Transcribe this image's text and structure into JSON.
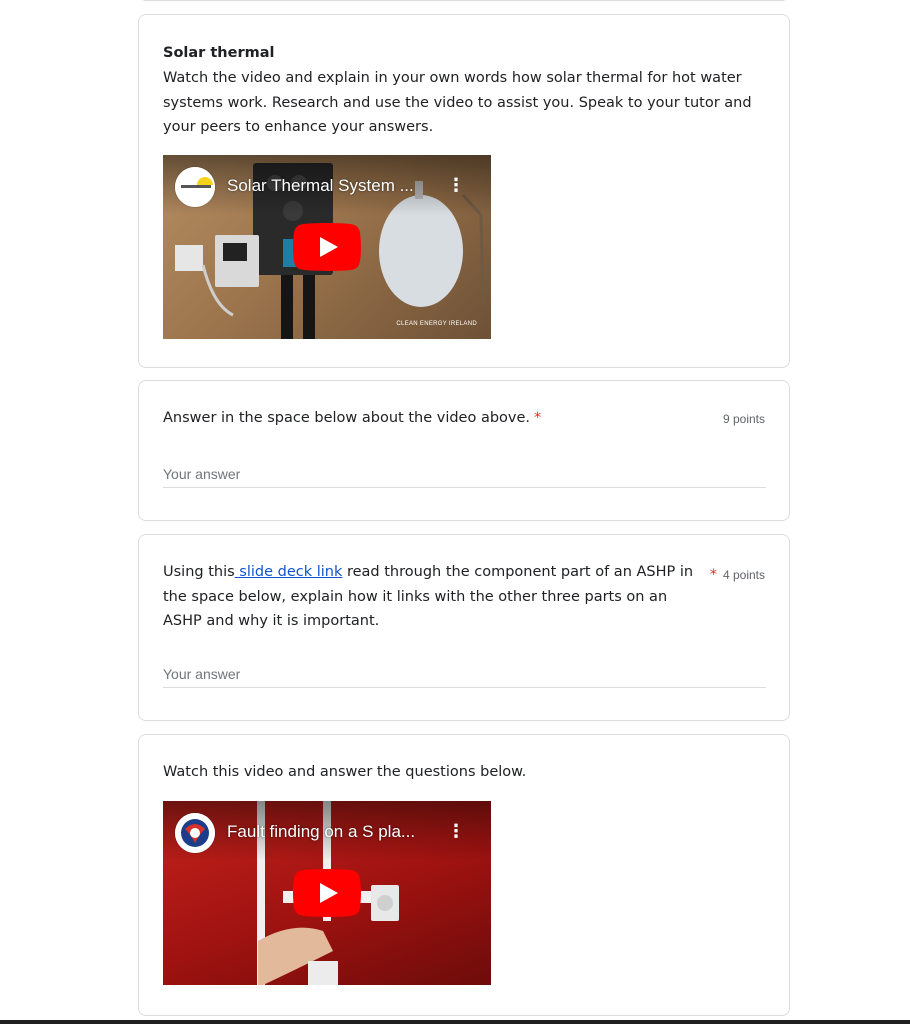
{
  "section": {
    "title": "Solar thermal",
    "description": "Watch the video and explain in your own words how solar thermal for hot water systems work. Research and use the video to assist you. Speak to your tutor and your peers to enhance your answers.",
    "video": {
      "title": "Solar Thermal System ...",
      "channel_icon": "clean-energy-ireland-logo",
      "watermark": "CLEAN ENERGY IRELAND"
    }
  },
  "questions": [
    {
      "text": "Answer in the space below about the video above.",
      "required_marker": "*",
      "points": "9 points",
      "placeholder": "Your answer"
    },
    {
      "text_before_link": "Using this",
      "link_text": " slide deck link",
      "text_after_link_line1": " read through the component part of an ASHP in",
      "text_line2": "the space below, explain how it links with the other three parts on an",
      "text_line3": "ASHP and why it is important.",
      "required_marker": "*",
      "points": "4 points",
      "placeholder": "Your answer"
    }
  ],
  "video_item": {
    "text": "Watch this video and answer the questions below.",
    "video": {
      "title": "Fault finding on a S pla...",
      "channel_icon": "channel-avatar-icon"
    }
  },
  "colors": {
    "required": "#d93025",
    "link": "#1155cc",
    "youtube_red": "#ff0000"
  }
}
